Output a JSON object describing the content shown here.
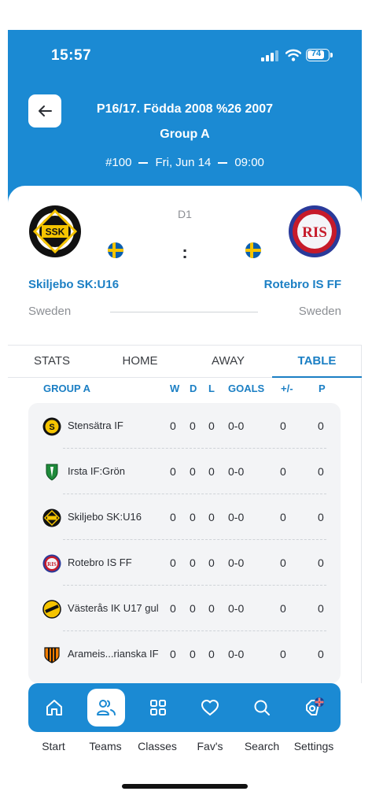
{
  "status_bar": {
    "time": "15:57",
    "battery": "74"
  },
  "header": {
    "title_line1": "P16/17. Födda 2008 %26 2007",
    "title_line2": "Group A",
    "match_number": "#100",
    "date": "Fri, Jun 14",
    "time": "09:00"
  },
  "match": {
    "round": "D1",
    "separator": ":",
    "home_team": "Skiljebo SK:U16",
    "away_team": "Rotebro IS FF",
    "home_country": "Sweden",
    "away_country": "Sweden"
  },
  "tabs": [
    "STATS",
    "HOME",
    "AWAY",
    "TABLE"
  ],
  "active_tab": "TABLE",
  "table": {
    "columns": {
      "group": "GROUP A",
      "w": "W",
      "d": "D",
      "l": "L",
      "goals": "GOALS",
      "diff": "+/-",
      "p": "P"
    },
    "rows": [
      {
        "team": "Stensätra IF",
        "w": "0",
        "d": "0",
        "l": "0",
        "goals": "0-0",
        "diff": "0",
        "p": "0",
        "icon": "stensatra-logo-icon"
      },
      {
        "team": "Irsta IF:Grön",
        "w": "0",
        "d": "0",
        "l": "0",
        "goals": "0-0",
        "diff": "0",
        "p": "0",
        "icon": "irsta-logo-icon"
      },
      {
        "team": "Skiljebo SK:U16",
        "w": "0",
        "d": "0",
        "l": "0",
        "goals": "0-0",
        "diff": "0",
        "p": "0",
        "icon": "skiljebo-logo-icon"
      },
      {
        "team": "Rotebro IS FF",
        "w": "0",
        "d": "0",
        "l": "0",
        "goals": "0-0",
        "diff": "0",
        "p": "0",
        "icon": "rotebro-logo-icon"
      },
      {
        "team": "Västerås IK U17 gul",
        "w": "0",
        "d": "0",
        "l": "0",
        "goals": "0-0",
        "diff": "0",
        "p": "0",
        "icon": "vasteras-logo-icon"
      },
      {
        "team": "Arameis...rianska IF",
        "w": "0",
        "d": "0",
        "l": "0",
        "goals": "0-0",
        "diff": "0",
        "p": "0",
        "icon": "arameiska-logo-icon"
      }
    ]
  },
  "nav": {
    "items": [
      {
        "label": "Start",
        "icon": "home-icon"
      },
      {
        "label": "Teams",
        "icon": "teams-icon"
      },
      {
        "label": "Classes",
        "icon": "grid-icon"
      },
      {
        "label": "Fav's",
        "icon": "heart-icon"
      },
      {
        "label": "Search",
        "icon": "search-icon"
      },
      {
        "label": "Settings",
        "icon": "settings-icon"
      }
    ],
    "active": "Teams"
  },
  "colors": {
    "brand": "#1b8ad3",
    "accent_text": "#1b7fc4",
    "table_bg": "#f3f4f6"
  }
}
